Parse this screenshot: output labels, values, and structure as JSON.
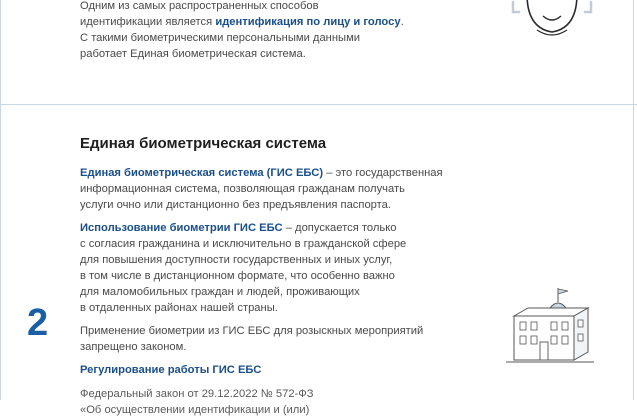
{
  "section1": {
    "line1": "Одним из самых распространенных способов",
    "line2_prefix": "идентификации является ",
    "line2_link": "идентификация по лицу и голосу",
    "line2_suffix": ".",
    "line3": "С такими биометрическими персональными данными",
    "line4": "работает Единая биометрическая система."
  },
  "section2": {
    "number": "2",
    "title": "Единая биометрическая система",
    "para1": {
      "link": "Единая биометрическая система (ГИС ЕБС)",
      "line1_rest": " – это государственная",
      "line2": "информационная система, позволяющая гражданам получать",
      "line3": "услуги очно или дистанционно без предъявления паспорта."
    },
    "para2": {
      "link": "Использование биометрии ГИС ЕБС",
      "line1_rest": " – допускается только",
      "line2": "с согласия гражданина и исключительно в гражданской сфере",
      "line3": "для повышения доступности государственных и иных услуг,",
      "line4": "в том числе в дистанционном формате, что особенно важно",
      "line5": "для маломобильных граждан и людей, проживающих",
      "line6": "в отдаленных районах нашей страны."
    },
    "para3": {
      "line1": "Применение биометрии из ГИС ЕБС для розыскных мероприятий",
      "line2": "запрещено законом."
    },
    "sub_heading": "Регулирование работы ГИС ЕБС",
    "law_line1": "Федеральный закон от 29.12.2022 № 572-ФЗ",
    "law_line2": "«Об осуществлении идентификации и (или)"
  },
  "colors": {
    "accent": "#1a4f8c",
    "number": "#1a5fa6",
    "divider": "#c9d7e3"
  },
  "icons": [
    "face-scan-icon",
    "government-building-icon"
  ]
}
